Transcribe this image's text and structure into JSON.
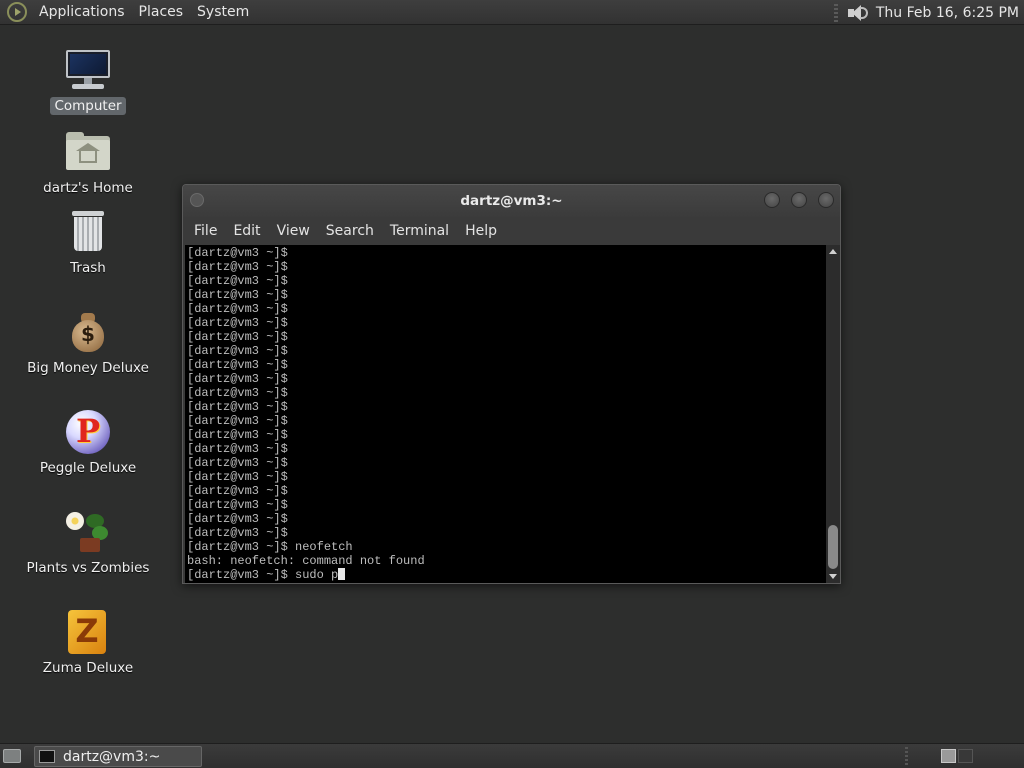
{
  "top_panel": {
    "menus": [
      "Applications",
      "Places",
      "System"
    ],
    "clock": "Thu Feb 16,  6:25 PM",
    "icons": {
      "menu_logo": "distro-logo-icon",
      "volume": "volume-icon"
    }
  },
  "desktop_icons": [
    {
      "label": "Computer",
      "icon": "computer-icon",
      "selected": true
    },
    {
      "label": "dartz's Home",
      "icon": "home-folder-icon"
    },
    {
      "label": "Trash",
      "icon": "trash-icon"
    },
    {
      "label": "Big Money Deluxe",
      "icon": "money-bag-icon"
    },
    {
      "label": "Peggle Deluxe",
      "icon": "peggle-icon"
    },
    {
      "label": "Plants vs Zombies",
      "icon": "plants-vs-zombies-icon"
    },
    {
      "label": "Zuma Deluxe",
      "icon": "zuma-icon"
    }
  ],
  "terminal": {
    "title": "dartz@vm3:~",
    "menu": [
      "File",
      "Edit",
      "View",
      "Search",
      "Terminal",
      "Help"
    ],
    "lines": [
      "[dartz@vm3 ~]$",
      "[dartz@vm3 ~]$",
      "[dartz@vm3 ~]$",
      "[dartz@vm3 ~]$",
      "[dartz@vm3 ~]$",
      "[dartz@vm3 ~]$",
      "[dartz@vm3 ~]$",
      "[dartz@vm3 ~]$",
      "[dartz@vm3 ~]$",
      "[dartz@vm3 ~]$",
      "[dartz@vm3 ~]$",
      "[dartz@vm3 ~]$",
      "[dartz@vm3 ~]$",
      "[dartz@vm3 ~]$",
      "[dartz@vm3 ~]$",
      "[dartz@vm3 ~]$",
      "[dartz@vm3 ~]$",
      "[dartz@vm3 ~]$",
      "[dartz@vm3 ~]$",
      "[dartz@vm3 ~]$",
      "[dartz@vm3 ~]$",
      "[dartz@vm3 ~]$ neofetch",
      "bash: neofetch: command not found"
    ],
    "current_input": "[dartz@vm3 ~]$ sudo p"
  },
  "bottom_panel": {
    "task_label": "dartz@vm3:~"
  }
}
